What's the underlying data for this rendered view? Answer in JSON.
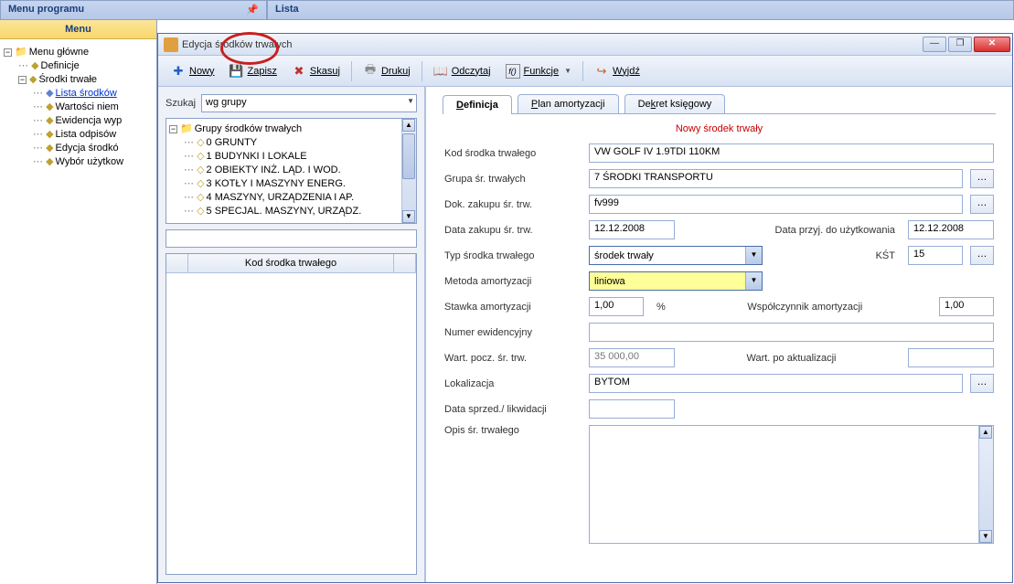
{
  "topPanels": {
    "left": "Menu programu",
    "right": "Lista"
  },
  "menuTitle": "Menu",
  "menuTree": {
    "root": "Menu główne",
    "definicje": "Definicje",
    "srodki": "Środki trwałe",
    "items": [
      "Lista środków",
      "Wartości niem",
      "Ewidencja wyp",
      "Lista odpisów",
      "Edycja środkó",
      "Wybór użytkow"
    ]
  },
  "modal": {
    "title": "Edycja środków trwałych",
    "toolbar": {
      "nowy": "Nowy",
      "zapisz": "Zapisz",
      "skasuj": "Skasuj",
      "drukuj": "Drukuj",
      "odczytaj": "Odczytaj",
      "funkcje": "Funkcje",
      "wyjdz": "Wyjdź"
    },
    "search": {
      "label": "Szukaj",
      "combo": "wg grupy",
      "groupTree": {
        "root": "Grupy środków trwałych",
        "items": [
          "0 GRUNTY",
          "1 BUDYNKI I LOKALE",
          "2 OBIEKTY INŻ. LĄD. I WOD.",
          "3 KOTŁY I MASZYNY ENERG.",
          "4 MASZYNY, URZĄDZENIA I AP.",
          "5 SPECJAL. MASZYNY, URZĄDZ."
        ]
      },
      "gridHeader": "Kod środka trwałego"
    },
    "tabs": {
      "definicja": "Definicja",
      "plan": "Plan amortyzacji",
      "dekret": "Dekret księgowy"
    },
    "formTitle": "Nowy środek trwały",
    "fields": {
      "kod_label": "Kod środka trwałego",
      "kod_value": "VW GOLF IV 1.9TDI 110KM",
      "grupa_label": "Grupa śr. trwałych",
      "grupa_value": "7 ŚRODKI TRANSPORTU",
      "dokzakup_label": "Dok. zakupu śr. trw.",
      "dokzakup_value": "fv999",
      "datazakup_label": "Data zakupu śr. trw.",
      "datazakup_value": "12.12.2008",
      "dataprzyj_label": "Data przyj. do użytkowania",
      "dataprzyj_value": "12.12.2008",
      "typ_label": "Typ środka trwałego",
      "typ_value": "środek trwały",
      "kst_label": "KŚT",
      "kst_value": "15",
      "metoda_label": "Metoda amortyzacji",
      "metoda_value": "liniowa",
      "stawka_label": "Stawka amortyzacji",
      "stawka_value": "1,00",
      "percent": "%",
      "wsp_label": "Współczynnik amortyzacji",
      "wsp_value": "1,00",
      "numer_label": "Numer ewidencyjny",
      "numer_value": "",
      "wartpocz_label": "Wart. pocz. śr. trw.",
      "wartpocz_value": "35 000,00",
      "wartpo_label": "Wart. po aktualizacji",
      "wartpo_value": "",
      "lok_label": "Lokalizacja",
      "lok_value": "BYTOM",
      "datasprzed_label": "Data sprzed./ likwidacji",
      "datasprzed_value": "",
      "opis_label": "Opis śr. trwałego",
      "opis_value": ""
    }
  }
}
